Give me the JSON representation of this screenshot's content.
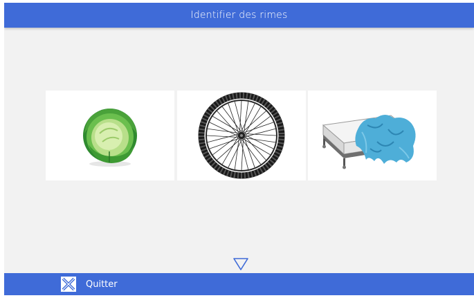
{
  "header": {
    "title": "Identifier des rimes"
  },
  "cards": [
    {
      "icon": "cabbage-image"
    },
    {
      "icon": "bicycle-wheel-image"
    },
    {
      "icon": "bed-image"
    }
  ],
  "navigation": {
    "next_icon": "triangle-down-icon"
  },
  "footer": {
    "quit_label": "Quitter",
    "quit_icon": "quit-x-icon"
  },
  "colors": {
    "accent": "#3f6bd8",
    "background": "#f2f2f2"
  }
}
